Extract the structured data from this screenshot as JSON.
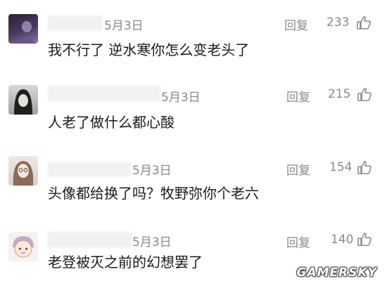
{
  "comments": [
    {
      "date": "5月3日",
      "reply": "回复",
      "likes": "233",
      "text": "我不行了 逆水寒你怎么变老头了"
    },
    {
      "date": "5月3日",
      "reply": "回复",
      "likes": "215",
      "text": "人老了做什么都心酸"
    },
    {
      "date": "5月3日",
      "reply": "回复",
      "likes": "154",
      "text": "头像都给换了吗？牧野弥你个老六"
    },
    {
      "date": "5月3日",
      "reply": "回复",
      "likes": "140",
      "text": "老登被灭之前的幻想罢了"
    }
  ],
  "watermark": "GAMERSKY",
  "colors": {
    "meta": "#8a8a8a",
    "text": "#1a1a1a",
    "background": "#ffffff"
  },
  "icons": {
    "like": "thumbs-up-icon"
  }
}
